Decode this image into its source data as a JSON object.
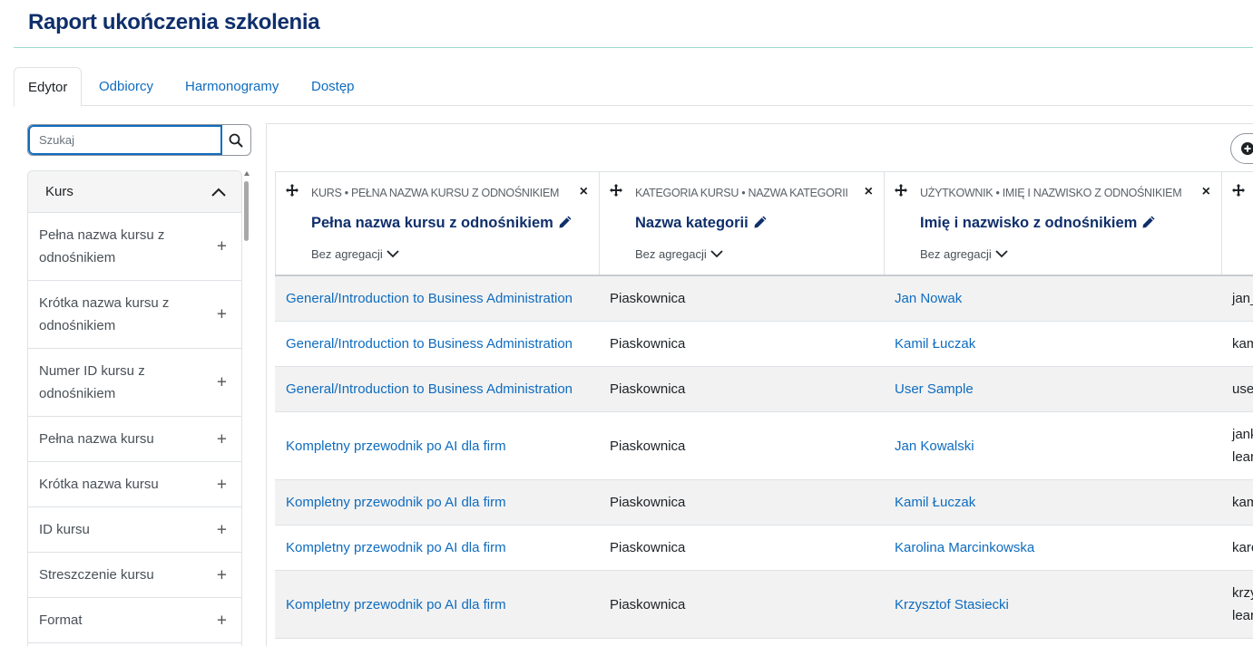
{
  "page": {
    "title": "Raport ukończenia szkolenia"
  },
  "tabs": [
    {
      "label": "Edytor",
      "active": true
    },
    {
      "label": "Odbiorcy",
      "active": false
    },
    {
      "label": "Harmonogramy",
      "active": false
    },
    {
      "label": "Dostęp",
      "active": false
    }
  ],
  "search": {
    "placeholder": "Szukaj",
    "value": "",
    "icon": "search-icon"
  },
  "sidebar": {
    "section_label": "Kurs",
    "items": [
      {
        "label": "Pełna nazwa kursu z odnośnikiem"
      },
      {
        "label": "Krótka nazwa kursu z odnośnikiem"
      },
      {
        "label": "Numer ID kursu z odnośnikiem"
      },
      {
        "label": "Pełna nazwa kursu"
      },
      {
        "label": "Krótka nazwa kursu"
      },
      {
        "label": "ID kursu"
      },
      {
        "label": "Streszczenie kursu"
      },
      {
        "label": "Format"
      }
    ]
  },
  "columns": [
    {
      "source": "KURS • PEŁNA NAZWA KURSU Z ODNOŚNIKIEM",
      "title": "Pełna nazwa kursu z odnośnikiem",
      "aggregation": "Bez agregacji"
    },
    {
      "source": "KATEGORIA KURSU • NAZWA KATEGORII",
      "title": "Nazwa kategorii",
      "aggregation": "Bez agregacji"
    },
    {
      "source": "UŻYTKOWNIK • IMIĘ I NAZWISKO Z ODNOŚNIKIEM",
      "title": "Imię i nazwisko z odnośnikiem",
      "aggregation": "Bez agregacji"
    }
  ],
  "rows": [
    {
      "course": "General/Introduction to Business Administration",
      "category": "Piaskownica",
      "user": "Jan Nowak",
      "extra_line1": "jan_",
      "extra_line2": ""
    },
    {
      "course": "General/Introduction to Business Administration",
      "category": "Piaskownica",
      "user": "Kamil Łuczak",
      "extra_line1": "kam",
      "extra_line2": ""
    },
    {
      "course": "General/Introduction to Business Administration",
      "category": "Piaskownica",
      "user": "User Sample",
      "extra_line1": "use",
      "extra_line2": ""
    },
    {
      "course": "Kompletny przewodnik po AI dla firm",
      "category": "Piaskownica",
      "user": "Jan Kowalski",
      "extra_line1": "jank",
      "extra_line2": "lear"
    },
    {
      "course": "Kompletny przewodnik po AI dla firm",
      "category": "Piaskownica",
      "user": "Kamil Łuczak",
      "extra_line1": "kam",
      "extra_line2": ""
    },
    {
      "course": "Kompletny przewodnik po AI dla firm",
      "category": "Piaskownica",
      "user": "Karolina Marcinkowska",
      "extra_line1": "karo",
      "extra_line2": ""
    },
    {
      "course": "Kompletny przewodnik po AI dla firm",
      "category": "Piaskownica",
      "user": "Krzysztof Stasiecki",
      "extra_line1": "krzy",
      "extra_line2": "lear"
    }
  ]
}
